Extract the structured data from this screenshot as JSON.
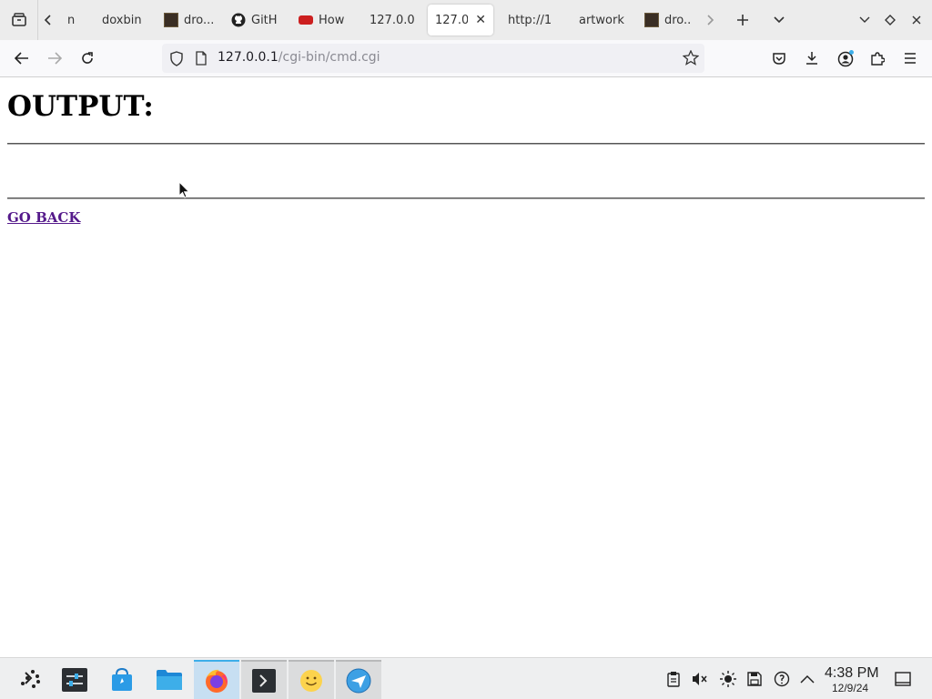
{
  "tabs": [
    {
      "label": "n",
      "favicon": "none",
      "active": false
    },
    {
      "label": "doxbin",
      "favicon": "none",
      "active": false
    },
    {
      "label": "dro...",
      "favicon": "dark-square-icon",
      "active": false
    },
    {
      "label": "GitH",
      "favicon": "github-icon",
      "active": false
    },
    {
      "label": "How",
      "favicon": "youtube-icon",
      "active": false
    },
    {
      "label": "127.0.0",
      "favicon": "none",
      "active": false
    },
    {
      "label": "127.0",
      "favicon": "none",
      "active": true
    },
    {
      "label": "http://1",
      "favicon": "none",
      "active": false
    },
    {
      "label": "artwork",
      "favicon": "none",
      "active": false
    },
    {
      "label": "dro...",
      "favicon": "dark-square-icon",
      "active": false
    }
  ],
  "urlbar": {
    "host": "127.0.0.1",
    "path": "/cgi-bin/cmd.cgi"
  },
  "page": {
    "heading": "OUTPUT:",
    "link": "GO BACK"
  },
  "taskbar": {
    "apps": [
      "launcher-icon",
      "system-settings-icon",
      "discover-store-icon",
      "dolphin-files-icon",
      "firefox-icon",
      "konsole-terminal-icon",
      "smiley-emoji-icon",
      "kde-connect-icon"
    ],
    "active_app": "firefox-icon",
    "clock_time": "4:38 PM",
    "clock_date": "12/9/24"
  },
  "colors": {
    "tabstrip_bg": "#ececec",
    "navbar_bg": "#f9f9fb",
    "urlbar_bg": "#f0f0f4",
    "visited_link": "#551a8b",
    "taskbar_bg": "#eeeff0",
    "active_task_accent": "#3daee9"
  }
}
